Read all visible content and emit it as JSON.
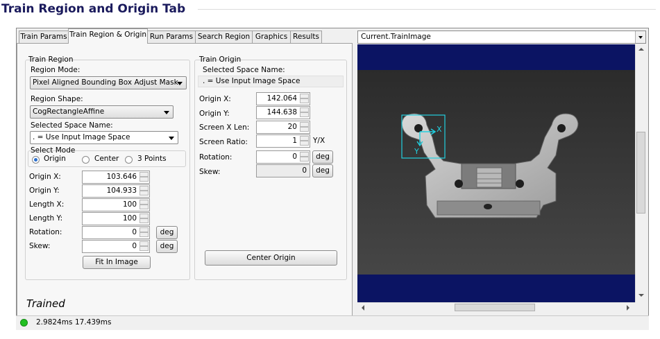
{
  "page": {
    "title": "Train Region and Origin Tab"
  },
  "tabs": [
    {
      "label": "Train Params",
      "active": false
    },
    {
      "label": "Train Region & Origin",
      "active": true
    },
    {
      "label": "Run Params",
      "active": false
    },
    {
      "label": "Search Region",
      "active": false
    },
    {
      "label": "Graphics",
      "active": false
    },
    {
      "label": "Results",
      "active": false
    }
  ],
  "train_region": {
    "group_label": "Train Region",
    "region_mode_label": "Region Mode:",
    "region_mode_value": "Pixel Aligned Bounding Box Adjust Mask",
    "region_shape_label": "Region Shape:",
    "region_shape_value": "CogRectangleAffine",
    "selected_space_label": "Selected Space Name:",
    "selected_space_value": ". = Use Input Image Space",
    "select_mode_label": "Select Mode",
    "select_mode_options": [
      "Origin",
      "Center",
      "3 Points"
    ],
    "select_mode_selected": "Origin",
    "origin_x_label": "Origin X:",
    "origin_x": "103.646",
    "origin_y_label": "Origin Y:",
    "origin_y": "104.933",
    "length_x_label": "Length X:",
    "length_x": "100",
    "length_y_label": "Length Y:",
    "length_y": "100",
    "rotation_label": "Rotation:",
    "rotation": "0",
    "skew_label": "Skew:",
    "skew": "0",
    "deg_label": "deg",
    "fit_in_image": "Fit In Image"
  },
  "train_origin": {
    "group_label": "Train Origin",
    "selected_space_label": "Selected Space Name:",
    "selected_space_value": ". = Use Input Image Space",
    "origin_x_label": "Origin X:",
    "origin_x": "142.064",
    "origin_y_label": "Origin Y:",
    "origin_y": "144.638",
    "screen_x_len_label": "Screen X Len:",
    "screen_x_len": "20",
    "screen_ratio_label": "Screen Ratio:",
    "screen_ratio": "1",
    "screen_ratio_unit": "Y/X",
    "rotation_label": "Rotation:",
    "rotation": "0",
    "skew_label": "Skew:",
    "skew": "0",
    "deg_label": "deg",
    "center_origin": "Center Origin"
  },
  "panel_status": "Trained",
  "image_view": {
    "selector_value": "Current.TrainImage",
    "axis_x_label": "X",
    "axis_y_label": "Y",
    "background_color": "#0b1463",
    "graphic_color": "#22d0e0"
  },
  "status_bar": {
    "time_1": "2.9824ms",
    "time_2": "17.439ms",
    "indicator_color": "#22c022"
  }
}
